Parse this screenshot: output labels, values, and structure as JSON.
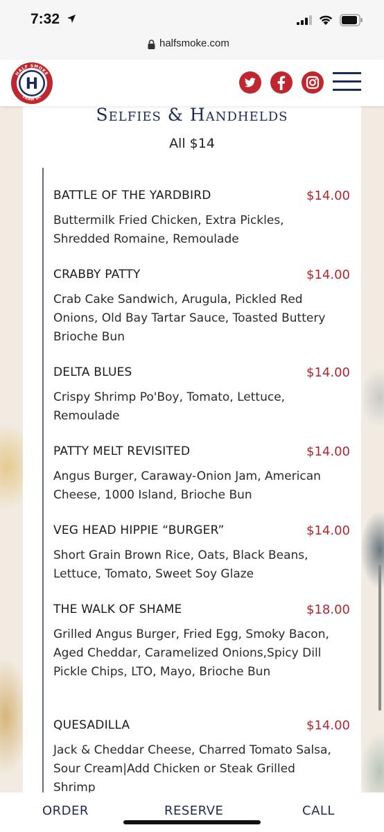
{
  "status_bar": {
    "time": "7:32"
  },
  "browser": {
    "url": "halfsmoke.com"
  },
  "header": {
    "logo": {
      "letter": "H",
      "top_text": "HALF SMOKE",
      "bottom_text": "SHAW DC"
    },
    "social": [
      "twitter-icon",
      "facebook-icon",
      "instagram-icon"
    ],
    "menu_icon": "hamburger-menu-icon"
  },
  "section": {
    "title": "Selfies & Handhelds",
    "subtitle": "All $14"
  },
  "items": [
    {
      "name": "BATTLE OF THE YARDBIRD",
      "price": "$14.00",
      "desc": "Buttermilk Fried Chicken, Extra Pickles, Shredded Romaine, Remoulade"
    },
    {
      "name": "CRABBY PATTY",
      "price": "$14.00",
      "desc": "Crab Cake Sandwich, Arugula, Pickled Red Onions, Old Bay Tartar Sauce, Toasted Buttery Brioche Bun"
    },
    {
      "name": "DELTA BLUES",
      "price": "$14.00",
      "desc": "Crispy Shrimp Po'Boy, Tomato, Lettuce, Remoulade"
    },
    {
      "name": "PATTY MELT REVISITED",
      "price": "$14.00",
      "desc": "Angus Burger, Caraway-Onion Jam, American Cheese, 1000 Island, Brioche Bun"
    },
    {
      "name": "VEG HEAD HIPPIE “BURGER”",
      "price": "$14.00",
      "desc": "Short Grain Brown Rice, Oats, Black Beans, Lettuce, Tomato, Sweet Soy Glaze"
    },
    {
      "name": "THE WALK OF SHAME",
      "price": "$18.00",
      "desc": "Grilled Angus Burger, Fried Egg, Smoky Bacon, Aged Cheddar, Caramelized Onions,Spicy Dill Pickle Chips, LTO, Mayo, Brioche Bun"
    },
    {
      "name": "QUESADILLA",
      "price": "$14.00",
      "desc": "Jack & Cheddar Cheese, Charred Tomato Salsa, Sour Cream|Add Chicken or Steak Grilled Shrimp"
    }
  ],
  "bottom_nav": {
    "order": "ORDER",
    "reserve": "RESERVE",
    "call": "CALL"
  },
  "colors": {
    "navy": "#1c2a5a",
    "red": "#c0262d",
    "price_red": "#b3252c"
  }
}
